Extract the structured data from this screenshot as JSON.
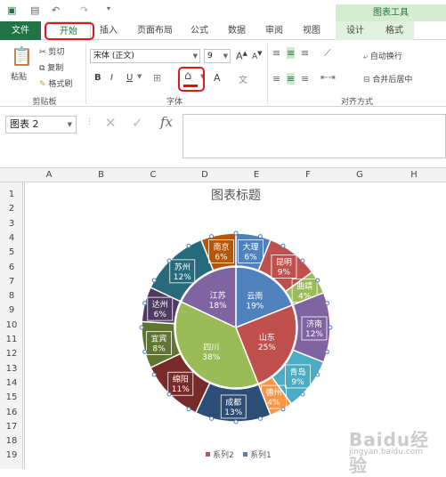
{
  "context_tab_group": "图表工具",
  "tabs": [
    "文件",
    "开始",
    "插入",
    "页面布局",
    "公式",
    "数据",
    "审阅",
    "视图",
    "设计",
    "格式"
  ],
  "clipboard": {
    "paste": "粘贴",
    "cut": "剪切",
    "copy": "复制",
    "format_painter": "格式刷",
    "label": "剪贴板"
  },
  "font": {
    "name": "宋体 (正文)",
    "size": "9",
    "label": "字体",
    "bold": "B",
    "italic": "I",
    "underline": "U",
    "color_a": "A",
    "grow": "A",
    "shrink": "A"
  },
  "alignment": {
    "wrap": "自动换行",
    "merge": "合并后居中",
    "label": "对齐方式"
  },
  "name_box": "图表 2",
  "columns": [
    "A",
    "B",
    "C",
    "D",
    "E",
    "F",
    "G",
    "H"
  ],
  "rows": [
    "1",
    "2",
    "3",
    "4",
    "5",
    "6",
    "7",
    "8",
    "9",
    "10",
    "11",
    "12",
    "13",
    "14",
    "15",
    "16",
    "17",
    "18",
    "19"
  ],
  "watermark": "Baidu经验",
  "watermark_sub": "jingyan.baidu.com",
  "chart_data": {
    "type": "pie",
    "title": "图表标题",
    "series": [
      {
        "name": "系列1",
        "labels": [
          "云南",
          "山东",
          "四川",
          "江苏"
        ],
        "values": [
          19,
          25,
          38,
          18
        ],
        "unit": "%",
        "colors": [
          "#4f81bd",
          "#c0504d",
          "#9bbb59",
          "#8064a2"
        ]
      },
      {
        "name": "系列2",
        "labels": [
          "大理",
          "昆明",
          "曲靖",
          "济南",
          "青岛",
          "德州",
          "成都",
          "绵阳",
          "宜宾",
          "达州",
          "苏州",
          "南京"
        ],
        "values": [
          6,
          9,
          4,
          12,
          9,
          4,
          13,
          11,
          8,
          6,
          12,
          6
        ],
        "unit": "%",
        "colors": [
          "#4f81bd",
          "#c0504d",
          "#9bbb59",
          "#8064a2",
          "#4bacc6",
          "#f79646",
          "#2c4d75",
          "#772c2a",
          "#5f7530",
          "#4d3b62",
          "#276a7c",
          "#b65708"
        ]
      }
    ],
    "legend": [
      "系列2",
      "系列1"
    ],
    "legend_position": "bottom"
  }
}
